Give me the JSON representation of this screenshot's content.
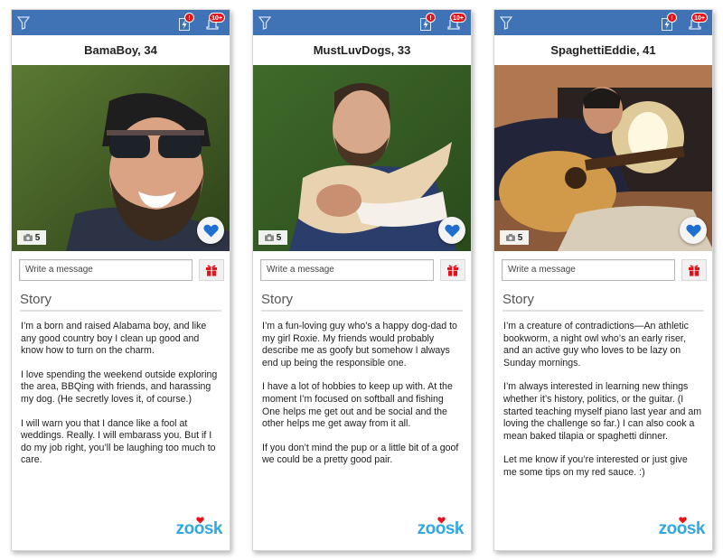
{
  "topbar": {
    "filter_icon": "filter-icon",
    "boost_icon": "lightning-icon",
    "boost_badge": "!",
    "notifications_icon": "bell-icon",
    "notifications_badge": "10+"
  },
  "colors": {
    "header_blue": "#3f73b6",
    "badge_red": "#e3121b",
    "like_blue": "#1f6fd1",
    "gift_red": "#e3121b",
    "logo_blue": "#31a8e0"
  },
  "story_heading": "Story",
  "message_placeholder": "Write a message",
  "logo_text": "zoosk",
  "profiles": [
    {
      "name": "BamaBoy, 34",
      "photo_count": "5",
      "story": [
        "I’m a born and raised Alabama boy, and like any good country boy I clean up good and know how to turn on the charm.",
        "I love spending the weekend outside exploring the area, BBQing with friends, and harassing my dog. (He secretly loves it, of course.)",
        "I will warn you that I dance like a fool at weddings. Really. I will embarass you. But if I do my job right, you’ll be laughing too much to care."
      ]
    },
    {
      "name": "MustLuvDogs, 33",
      "photo_count": "5",
      "story": [
        "I’m a fun-loving guy who’s a happy dog-dad to my girl Roxie. My friends would probably describe me as goofy but somehow I always end up being the responsible one.",
        "I have a lot of hobbies to keep up with. At the moment I’m focused on softball and fishing One helps me get out and be social and the other helps me get away from it all.",
        "If you don’t mind the pup or a little bit of a goof we could be a pretty good pair."
      ]
    },
    {
      "name": "SpaghettiEddie, 41",
      "photo_count": "5",
      "story": [
        "I’m a creature of contradictions—An athletic bookworm, a night owl who’s an early riser, and an active guy who loves to be lazy on Sunday mornings.",
        "I’m always interested in learning new things whether it’s history, politics, or the guitar. (I started teaching myself piano last year and am loving the challenge so far.) I can also cook a mean baked tilapia or spaghetti dinner.",
        "Let me know if you’re interested or just give me some tips on my red sauce. :)"
      ]
    }
  ]
}
